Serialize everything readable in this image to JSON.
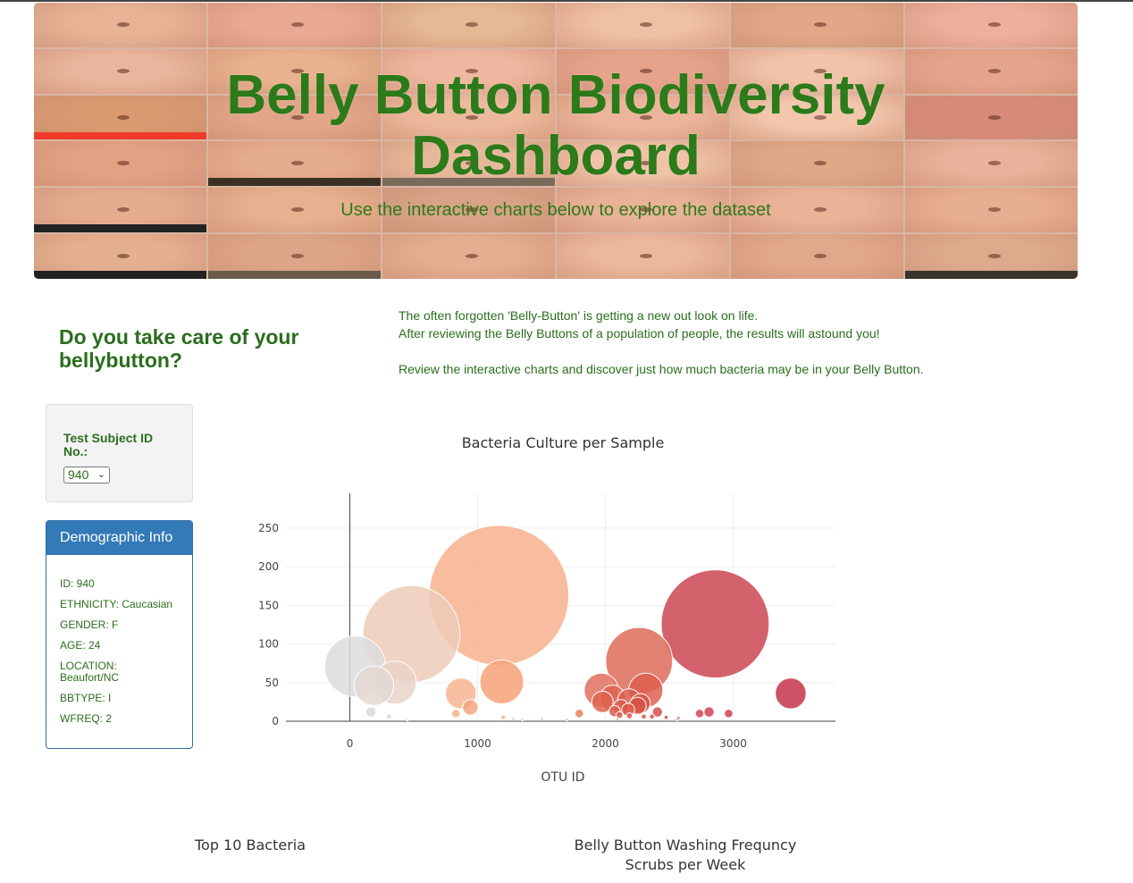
{
  "hero": {
    "title_line1": "Belly Button Biodiversity",
    "title_line2": "Dashboard",
    "subtitle": "Use the interactive charts below to explore the dataset"
  },
  "intro": {
    "question": "Do you take care of your bellybutton?",
    "line1": "The often forgotten 'Belly-Button' is getting a new out look on life.",
    "line2": "After reviewing the Belly Buttons of a population of people, the results will astound you!",
    "line3": "Review the interactive charts and discover just how much bacteria may be in your Belly Button."
  },
  "selector": {
    "label": "Test Subject ID No.:",
    "selected": "940"
  },
  "demographics": {
    "heading": "Demographic Info",
    "rows": [
      "ID: 940",
      "ETHNICITY: Caucasian",
      "GENDER: F",
      "AGE: 24",
      "LOCATION: Beaufort/NC",
      "BBTYPE: I",
      "WFREQ: 2"
    ]
  },
  "bubble_chart": {
    "title": "Bacteria Culture per Sample",
    "xlabel": "OTU ID"
  },
  "bar_chart": {
    "title": "Top 10 Bacteria"
  },
  "gauge_chart": {
    "title_line1": "Belly Button Washing Frequncy",
    "title_line2": "Scrubs per Week"
  },
  "colors": {
    "heading_green": "#2a6e1c",
    "panel_blue": "#337ab7"
  },
  "chart_data": {
    "type": "scatter",
    "title": "Bacteria Culture per Sample",
    "xlabel": "OTU ID",
    "ylabel": "",
    "xlim": [
      -500,
      3800
    ],
    "ylim": [
      0,
      295
    ],
    "xticks": [
      0,
      1000,
      2000,
      3000
    ],
    "yticks": [
      0,
      50,
      100,
      150,
      200,
      250
    ],
    "grid": true,
    "points": [
      {
        "x": 1167,
        "y": 163,
        "size": 163,
        "color": "#f7b08d"
      },
      {
        "x": 482,
        "y": 113,
        "size": 113,
        "color": "#edcbb7"
      },
      {
        "x": 41,
        "y": 71,
        "size": 71,
        "color": "#dcdcdc"
      },
      {
        "x": 2859,
        "y": 126,
        "size": 126,
        "color": "#cd4652"
      },
      {
        "x": 2264,
        "y": 78,
        "size": 78,
        "color": "#de6c5b"
      },
      {
        "x": 1189,
        "y": 51,
        "size": 51,
        "color": "#f6a178"
      },
      {
        "x": 352,
        "y": 50,
        "size": 50,
        "color": "#e9d2c7"
      },
      {
        "x": 189,
        "y": 46,
        "size": 46,
        "color": "#e3d8d2"
      },
      {
        "x": 2316,
        "y": 40,
        "size": 40,
        "color": "#dd604f"
      },
      {
        "x": 1968,
        "y": 40,
        "size": 40,
        "color": "#e0705d"
      },
      {
        "x": 3450,
        "y": 36,
        "size": 36,
        "color": "#c4344a"
      },
      {
        "x": 869,
        "y": 36,
        "size": 36,
        "color": "#f7b590"
      },
      {
        "x": 2056,
        "y": 30,
        "size": 30,
        "color": "#de6352"
      },
      {
        "x": 2186,
        "y": 27,
        "size": 27,
        "color": "#db5c4c"
      },
      {
        "x": 1977,
        "y": 25,
        "size": 25,
        "color": "#df6550"
      },
      {
        "x": 2274,
        "y": 23,
        "size": 23,
        "color": "#d95546"
      },
      {
        "x": 2251,
        "y": 20,
        "size": 20,
        "color": "#d95447"
      },
      {
        "x": 2122,
        "y": 18,
        "size": 18,
        "color": "#dc5d4d"
      },
      {
        "x": 943,
        "y": 18,
        "size": 18,
        "color": "#f6a480"
      },
      {
        "x": 2178,
        "y": 15,
        "size": 15,
        "color": "#da5848"
      },
      {
        "x": 2071,
        "y": 13,
        "size": 13,
        "color": "#dc5e4d"
      },
      {
        "x": 2407,
        "y": 12,
        "size": 12,
        "color": "#d4504a"
      },
      {
        "x": 165,
        "y": 12,
        "size": 12,
        "color": "#e0d7d2"
      },
      {
        "x": 2811,
        "y": 12,
        "size": 12,
        "color": "#cf4450"
      },
      {
        "x": 2737,
        "y": 10,
        "size": 10,
        "color": "#cf4852"
      },
      {
        "x": 2964,
        "y": 10,
        "size": 10,
        "color": "#cc4250"
      },
      {
        "x": 1795,
        "y": 10,
        "size": 10,
        "color": "#e67f5f"
      },
      {
        "x": 830,
        "y": 10,
        "size": 10,
        "color": "#f7b28d"
      },
      {
        "x": 2110,
        "y": 8,
        "size": 8,
        "color": "#dc5d4d"
      },
      {
        "x": 2188,
        "y": 7,
        "size": 7,
        "color": "#db5b4b"
      },
      {
        "x": 2300,
        "y": 6,
        "size": 6,
        "color": "#d9574a"
      },
      {
        "x": 2364,
        "y": 6,
        "size": 6,
        "color": "#d65349"
      },
      {
        "x": 307,
        "y": 6,
        "size": 6,
        "color": "#e7d4cb"
      },
      {
        "x": 1200,
        "y": 5,
        "size": 5,
        "color": "#f6a27b"
      },
      {
        "x": 2475,
        "y": 5,
        "size": 5,
        "color": "#d34e4b"
      },
      {
        "x": 2571,
        "y": 4,
        "size": 4,
        "color": "#d24c4c"
      },
      {
        "x": 1505,
        "y": 3,
        "size": 3,
        "color": "#f39070"
      },
      {
        "x": 1278,
        "y": 3,
        "size": 3,
        "color": "#f59c77"
      },
      {
        "x": 2096,
        "y": 3,
        "size": 3,
        "color": "#dc5e4d"
      },
      {
        "x": 450,
        "y": 2,
        "size": 2,
        "color": "#eccdbc"
      },
      {
        "x": 1350,
        "y": 2,
        "size": 2,
        "color": "#f49874"
      },
      {
        "x": 1700,
        "y": 2,
        "size": 2,
        "color": "#ea8664"
      },
      {
        "x": 2560,
        "y": 2,
        "size": 2,
        "color": "#d24c4c"
      }
    ]
  }
}
